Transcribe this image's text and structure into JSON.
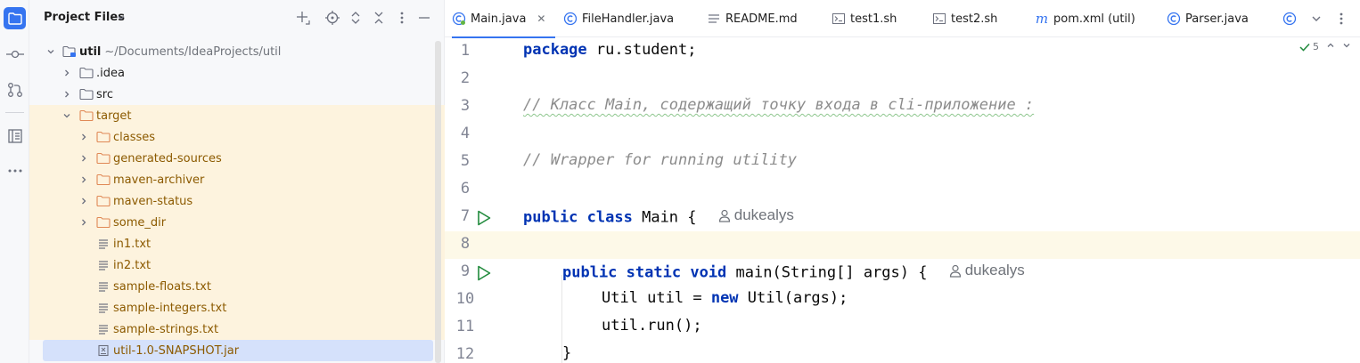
{
  "activity_bar": {
    "items": [
      "project-icon",
      "commit-icon",
      "pull-requests-icon",
      "structure-icon",
      "more-icon"
    ]
  },
  "project_panel": {
    "title": "Project Files",
    "tree": [
      {
        "label": "util",
        "hint": "~/Documents/IdeaProjects/util",
        "type": "module",
        "expanded": true
      },
      {
        "label": ".idea",
        "type": "folder"
      },
      {
        "label": "src",
        "type": "folder"
      },
      {
        "label": "target",
        "type": "folder-excluded",
        "expanded": true
      },
      {
        "label": "classes",
        "type": "folder-excluded"
      },
      {
        "label": "generated-sources",
        "type": "folder-excluded"
      },
      {
        "label": "maven-archiver",
        "type": "folder-excluded"
      },
      {
        "label": "maven-status",
        "type": "folder-excluded"
      },
      {
        "label": "some_dir",
        "type": "folder-excluded"
      },
      {
        "label": "in1.txt",
        "type": "text-file"
      },
      {
        "label": "in2.txt",
        "type": "text-file"
      },
      {
        "label": "sample-floats.txt",
        "type": "text-file"
      },
      {
        "label": "sample-integers.txt",
        "type": "text-file"
      },
      {
        "label": "sample-strings.txt",
        "type": "text-file"
      },
      {
        "label": "util-1.0-SNAPSHOT.jar",
        "type": "jar-file",
        "selected": true
      }
    ]
  },
  "editor": {
    "tabs": [
      {
        "label": "Main.java",
        "icon": "java-class-icon",
        "active": true
      },
      {
        "label": "FileHandler.java",
        "icon": "java-class-icon"
      },
      {
        "label": "README.md",
        "icon": "markdown-icon"
      },
      {
        "label": "test1.sh",
        "icon": "shell-script-icon"
      },
      {
        "label": "test2.sh",
        "icon": "shell-script-icon"
      },
      {
        "label": "pom.xml (util)",
        "icon": "maven-icon"
      },
      {
        "label": "Parser.java",
        "icon": "java-class-icon"
      }
    ],
    "inspection_count": "5",
    "lines": {
      "l1": {
        "num": "1",
        "kw": "package",
        "rest": " ru.student;"
      },
      "l2": {
        "num": "2"
      },
      "l3": {
        "num": "3",
        "comment": "// Класс Main, содержащий точку входа в cli-приложение :"
      },
      "l4": {
        "num": "4"
      },
      "l5": {
        "num": "5",
        "comment": "// Wrapper for running utility"
      },
      "l6": {
        "num": "6"
      },
      "l7": {
        "num": "7",
        "kw1": "public",
        "kw2": "class",
        "rest": " Main { ",
        "author": "dukealys"
      },
      "l8": {
        "num": "8"
      },
      "l9": {
        "num": "9",
        "kw1": "public",
        "kw2": "static",
        "kw3": "void",
        "rest": " main(String[] args) { ",
        "author": "dukealys"
      },
      "l10": {
        "num": "10",
        "pre": "Util util = ",
        "kw": "new",
        "rest": " Util(args);"
      },
      "l11": {
        "num": "11",
        "code": "util.run();"
      },
      "l12": {
        "num": "12",
        "code": "}"
      }
    }
  },
  "colors": {
    "accent": "#3574f0",
    "keyword": "#0033b3",
    "comment": "#8c8c8c",
    "excluded_folder": "#8c5a00",
    "highlight_row": "#fdf3de",
    "selected_row": "#d5e1fb",
    "run_green": "#208a3c"
  }
}
